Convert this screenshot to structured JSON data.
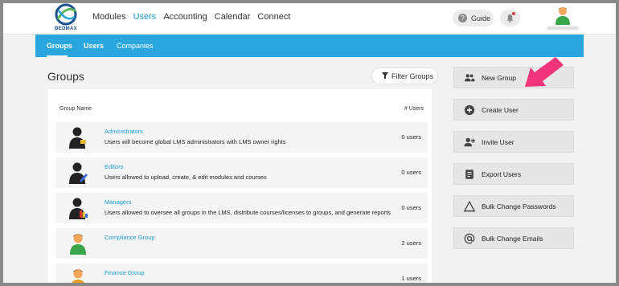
{
  "brand": {
    "logo_text": "BEDMAX"
  },
  "nav": {
    "items": [
      "Modules",
      "Users",
      "Accounting",
      "Calendar",
      "Connect"
    ],
    "active_index": 1
  },
  "header_actions": {
    "guide_label": "Guide",
    "bell_icon": "bell-icon",
    "avatar_icon": "user-avatar-icon"
  },
  "subnav": {
    "items": [
      "Groups",
      "Users",
      "Companies"
    ],
    "active": "Groups"
  },
  "page": {
    "title": "Groups",
    "filter_label": "Filter Groups"
  },
  "table": {
    "col_name": "Group Name",
    "col_users": "# Users",
    "rows": [
      {
        "name": "Administrators",
        "desc": "Users will become global LMS administrators with LMS owner rights",
        "count": "0 users",
        "icon": "admin-silhouette-icon"
      },
      {
        "name": "Editors",
        "desc": "Users allowed to upload, create, & edit modules and courses",
        "count": "0 users",
        "icon": "editor-silhouette-icon"
      },
      {
        "name": "Managers",
        "desc": "Users allowed to oversee all groups in the LMS, distribute courses/licenses to groups, and generate reports",
        "count": "0 users",
        "icon": "manager-silhouette-icon"
      },
      {
        "name": "Compliance Group",
        "desc": "",
        "count": "2 users",
        "icon": "person-avatar-icon"
      },
      {
        "name": "Finance Group",
        "desc": "",
        "count": "1 users",
        "icon": "person-avatar-icon"
      }
    ]
  },
  "sidebar": {
    "buttons": [
      {
        "label": "New Group",
        "icon": "group-icon"
      },
      {
        "label": "Create User",
        "icon": "plus-circle-icon"
      },
      {
        "label": "Invite User",
        "icon": "person-add-icon"
      },
      {
        "label": "Export Users",
        "icon": "document-icon"
      },
      {
        "label": "Bulk Change Passwords",
        "icon": "warning-triangle-icon"
      },
      {
        "label": "Bulk Change Emails",
        "icon": "at-sign-icon"
      }
    ]
  },
  "colors": {
    "accent": "#2aa6de",
    "link": "#1a9bd7",
    "arrow": "#f0357a"
  }
}
